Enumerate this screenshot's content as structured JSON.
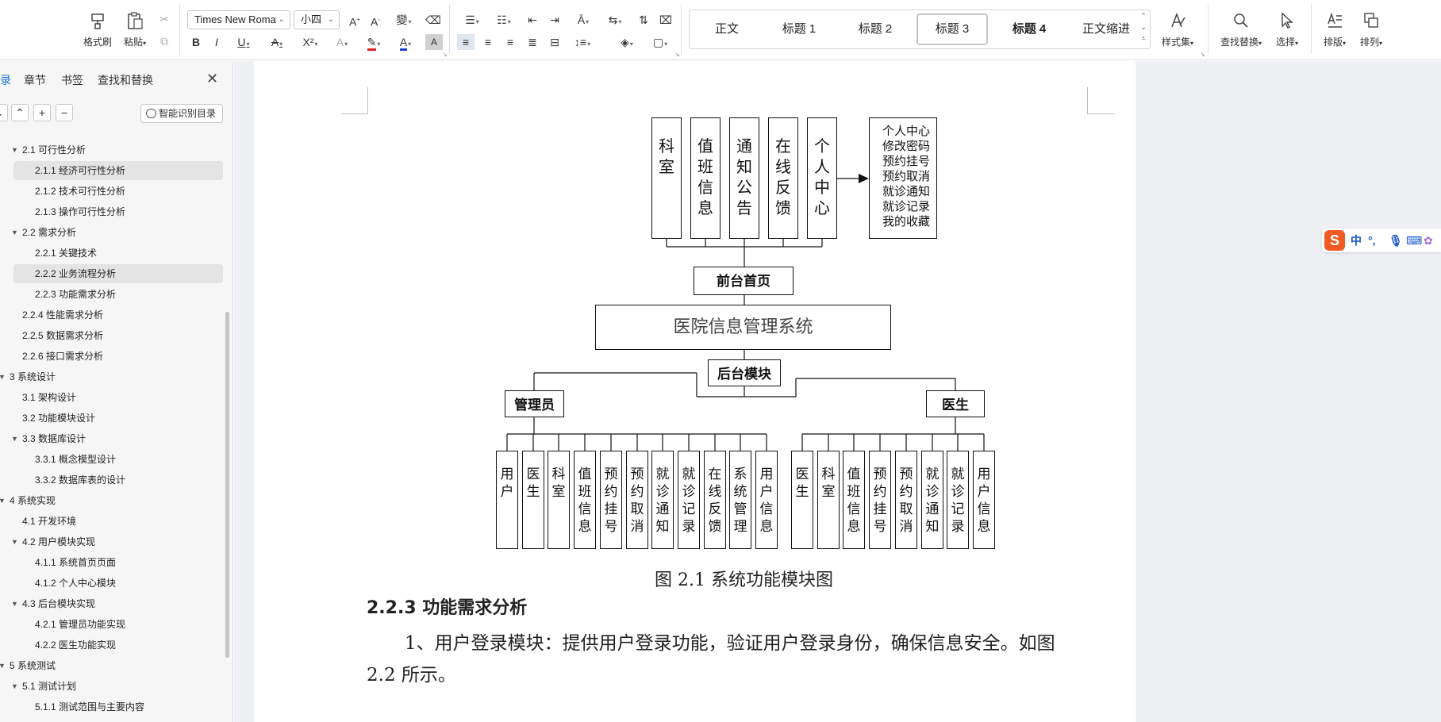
{
  "ribbon": {
    "clipboard": {
      "format_painter": "格式刷",
      "paste": "粘贴"
    },
    "font": {
      "name": "Times New Roma",
      "size": "小四"
    },
    "styles": {
      "items": [
        "正文",
        "标题 1",
        "标题 2",
        "标题 3",
        "标题 4",
        "正文缩进"
      ],
      "selected": "标题 3"
    },
    "style_set": "样式集",
    "find_replace": "查找替换",
    "select": "选择",
    "typeset": "排版",
    "arrange": "排列"
  },
  "nav": {
    "tabs": [
      "录",
      "章节",
      "书签",
      "查找和替换"
    ],
    "active_tab": "录",
    "smart_toc": "智能识别目录",
    "toc": [
      {
        "text": "2.1  可行性分析",
        "level": 2,
        "expanded": true
      },
      {
        "text": "2.1.1  经济可行性分析",
        "level": 3,
        "selected": true
      },
      {
        "text": "2.1.2  技术可行性分析",
        "level": 3
      },
      {
        "text": "2.1.3  操作可行性分析",
        "level": 3
      },
      {
        "text": "2.2  需求分析",
        "level": 2,
        "expanded": true
      },
      {
        "text": "2.2.1 关键技术",
        "level": 3
      },
      {
        "text": "2.2.2  业务流程分析",
        "level": 3,
        "selected": true
      },
      {
        "text": "2.2.3  功能需求分析",
        "level": 3
      },
      {
        "text": "2.2.4  性能需求分析",
        "level": 2
      },
      {
        "text": "2.2.5  数据需求分析",
        "level": 2
      },
      {
        "text": "2.2.6  接口需求分析",
        "level": 2
      },
      {
        "text": "3  系统设计",
        "level": 1,
        "expanded": true
      },
      {
        "text": "3.1  架构设计",
        "level": 2
      },
      {
        "text": "3.2  功能模块设计",
        "level": 2
      },
      {
        "text": "3.3  数据库设计",
        "level": 2,
        "expanded": true
      },
      {
        "text": "3.3.1  概念模型设计",
        "level": 3
      },
      {
        "text": "3.3.2  数据库表的设计",
        "level": 3
      },
      {
        "text": "4  系统实现",
        "level": 1,
        "expanded": true
      },
      {
        "text": "4.1  开发环境",
        "level": 2
      },
      {
        "text": "4.2  用户模块实现",
        "level": 2,
        "expanded": true
      },
      {
        "text": "4.1.1 系统首页页面",
        "level": 3
      },
      {
        "text": "4.1.2 个人中心模块",
        "level": 3
      },
      {
        "text": "4.3 后台模块实现",
        "level": 2,
        "expanded": true
      },
      {
        "text": "4.2.1 管理员功能实现",
        "level": 3
      },
      {
        "text": "4.2.2 医生功能实现",
        "level": 3
      },
      {
        "text": "5  系统测试",
        "level": 1,
        "expanded": true
      },
      {
        "text": "5.1  测试计划",
        "level": 2,
        "expanded": true
      },
      {
        "text": "5.1.1  测试范围与主要内容",
        "level": 3
      }
    ]
  },
  "document": {
    "diagram": {
      "front_modules": [
        "科室",
        "值班信息",
        "通知公告",
        "在线反馈",
        "个人中心"
      ],
      "personal_center_items": [
        "个人中心",
        "修改密码",
        "预约挂号",
        "预约取消",
        "就诊通知",
        "就诊记录",
        "我的收藏"
      ],
      "front_home": "前台首页",
      "system_name": "医院信息管理系统",
      "backend": "后台模块",
      "admin": "管理员",
      "doctor": "医生",
      "admin_modules": [
        "用户",
        "医生",
        "科室",
        "值班信息",
        "预约挂号",
        "预约取消",
        "就诊通知",
        "就诊记录",
        "在线反馈",
        "系统管理",
        "用户信息"
      ],
      "doctor_modules": [
        "医生",
        "科室",
        "值班信息",
        "预约挂号",
        "预约取消",
        "就诊通知",
        "就诊记录",
        "用户信息"
      ]
    },
    "caption": "图 2.1 系统功能模块图",
    "heading": "2.2.3  功能需求分析",
    "paragraph_line1": "1、用户登录模块：提供用户登录功能，验证用户登录身份，确保信息安全。如图",
    "paragraph_line2": "2.2 所示。"
  },
  "ime": {
    "mode": "中",
    "punct": "°,"
  }
}
